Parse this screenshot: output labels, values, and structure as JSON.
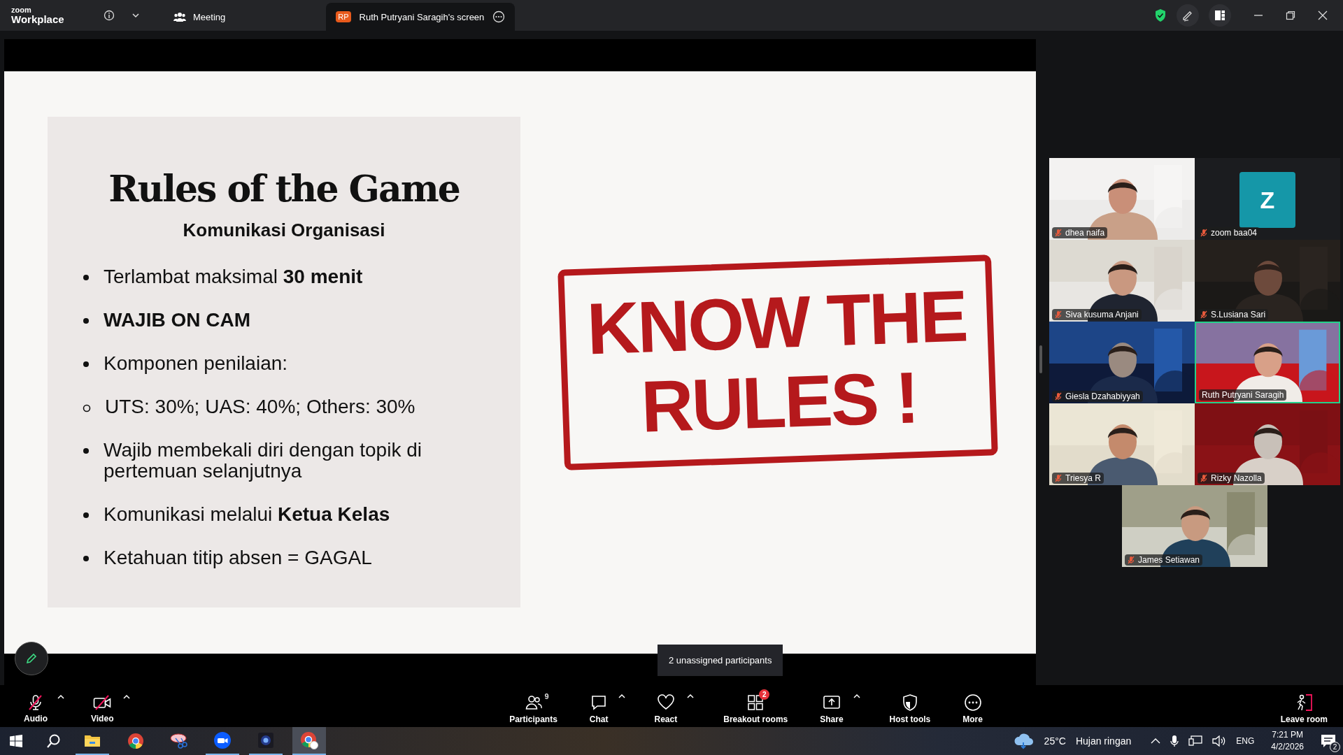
{
  "title_bar": {
    "logo_top": "zoom",
    "logo_bottom": "Workplace",
    "tabs": [
      {
        "label": "Meeting",
        "kind": "meeting",
        "selected": false
      },
      {
        "label": "Ruth Putryani Saragih's screen",
        "kind": "screen",
        "badge": "RP",
        "selected": true
      }
    ]
  },
  "slide": {
    "title": "Rules of the Game",
    "subtitle": "Komunikasi Organisasi",
    "bullets": [
      {
        "text": "Terlambat maksimal **30 menit**",
        "kind": "bullet"
      },
      {
        "text": "**WAJIB ON CAM**",
        "kind": "bullet"
      },
      {
        "text": "Komponen penilaian:",
        "kind": "bullet"
      },
      {
        "text": "UTS: 30%; UAS: 40%; Others: 30%",
        "kind": "sub"
      },
      {
        "text": "Wajib membekali diri dengan topik di pertemuan selanjutnya",
        "kind": "bullet"
      },
      {
        "text": "Komunikasi melalui **Ketua Kelas**",
        "kind": "bullet"
      },
      {
        "text": "Ketahuan titip absen = GAGAL",
        "kind": "bullet"
      }
    ],
    "stamp": [
      "KNOW THE",
      "RULES !"
    ]
  },
  "participants": [
    {
      "name": "dhea naifa",
      "kind": "video",
      "muted": true,
      "selected": false
    },
    {
      "name": "zoom baa04",
      "kind": "avatar",
      "initial": "Z",
      "muted": true,
      "selected": false
    },
    {
      "name": "Siva kusuma Anjani",
      "kind": "video",
      "muted": true,
      "selected": false
    },
    {
      "name": "S.Lusiana Sari",
      "kind": "video",
      "muted": true,
      "selected": false
    },
    {
      "name": "Giesla Dzahabiyyah",
      "kind": "video",
      "muted": true,
      "selected": false
    },
    {
      "name": "Ruth Putryani Saragih",
      "kind": "video",
      "muted": false,
      "selected": true
    },
    {
      "name": "Triesya R",
      "kind": "video",
      "muted": true,
      "selected": false
    },
    {
      "name": "Rizky Nazolla",
      "kind": "video",
      "muted": true,
      "selected": false
    },
    {
      "name": "James Setiawan",
      "kind": "video",
      "muted": true,
      "selected": false
    }
  ],
  "tooltip": "2 unassigned participants",
  "toolbar_left": [
    {
      "label": "Audio",
      "kind": "audio",
      "off": true,
      "menu": true
    },
    {
      "label": "Video",
      "kind": "video",
      "off": true,
      "menu": true
    }
  ],
  "toolbar_center": [
    {
      "label": "Participants",
      "kind": "participants",
      "count": "9"
    },
    {
      "label": "Chat",
      "kind": "chat",
      "menu": true
    },
    {
      "label": "React",
      "kind": "react",
      "menu": true
    },
    {
      "label": "Breakout rooms",
      "kind": "breakout",
      "badge": "2"
    },
    {
      "label": "Share",
      "kind": "share",
      "menu": true
    },
    {
      "label": "Host tools",
      "kind": "host"
    },
    {
      "label": "More",
      "kind": "more"
    }
  ],
  "toolbar_right": [
    {
      "label": "Leave room",
      "kind": "leave"
    }
  ],
  "taskbar": {
    "weather": "25°C",
    "weather_text": "Hujan ringan",
    "language": "ENG",
    "time": "7:21 PM",
    "date": "4/2/2026",
    "notifications": "2"
  }
}
